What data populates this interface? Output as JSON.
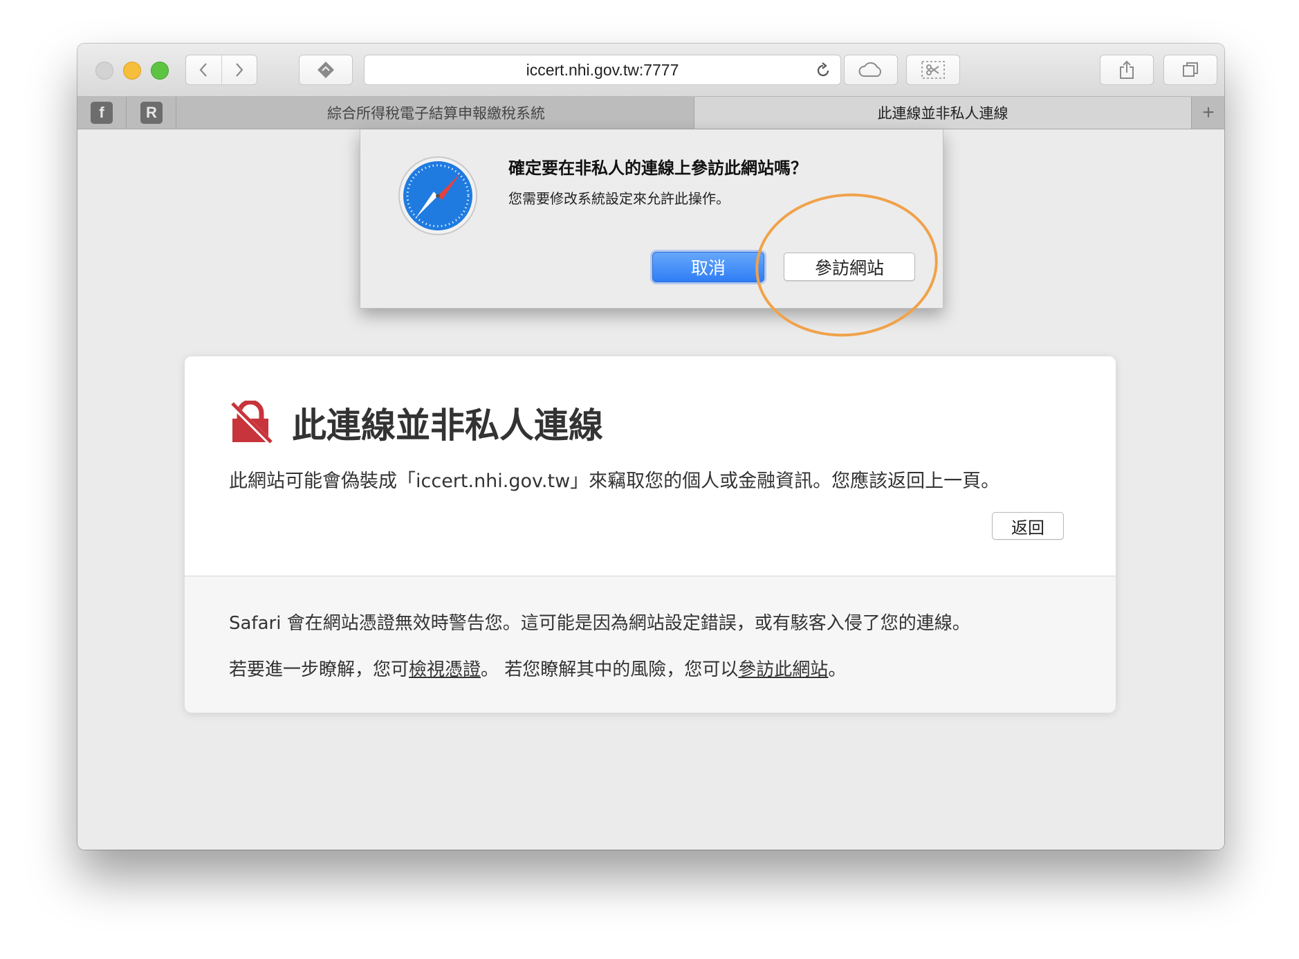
{
  "browser": {
    "url": "iccert.nhi.gov.tw:7777",
    "tabs": [
      {
        "label": "綜合所得稅電子結算申報繳稅系統",
        "active": false
      },
      {
        "label": "此連線並非私人連線",
        "active": true
      }
    ],
    "favorites": [
      {
        "icon": "facebook-icon",
        "glyph": "f"
      },
      {
        "icon": "r-bookmark-icon",
        "glyph": "R"
      }
    ],
    "new_tab_glyph": "+"
  },
  "sheet": {
    "title": "確定要在非私人的連線上參訪此網站嗎？",
    "message": "您需要修改系統設定來允許此操作。",
    "cancel_label": "取消",
    "visit_label": "參訪網站"
  },
  "warning": {
    "title": "此連線並非私人連線",
    "description": "此網站可能會偽裝成「iccert.nhi.gov.tw」來竊取您的個人或金融資訊。您應該返回上一頁。",
    "back_label": "返回",
    "info_line1": "Safari 會在網站憑證無效時警告您。這可能是因為網站設定錯誤，或有駭客入侵了您的連線。",
    "info_line2_prefix": "若要進一步瞭解，您可",
    "view_cert_link": "檢視憑證",
    "info_line2_middle": "。 若您瞭解其中的風險，您可以",
    "visit_link": "參訪此網站",
    "info_line2_suffix": "。"
  },
  "colors": {
    "accent_blue": "#2f7df6",
    "warning_red": "#c8343b",
    "annotation_orange": "#f0a24a"
  }
}
